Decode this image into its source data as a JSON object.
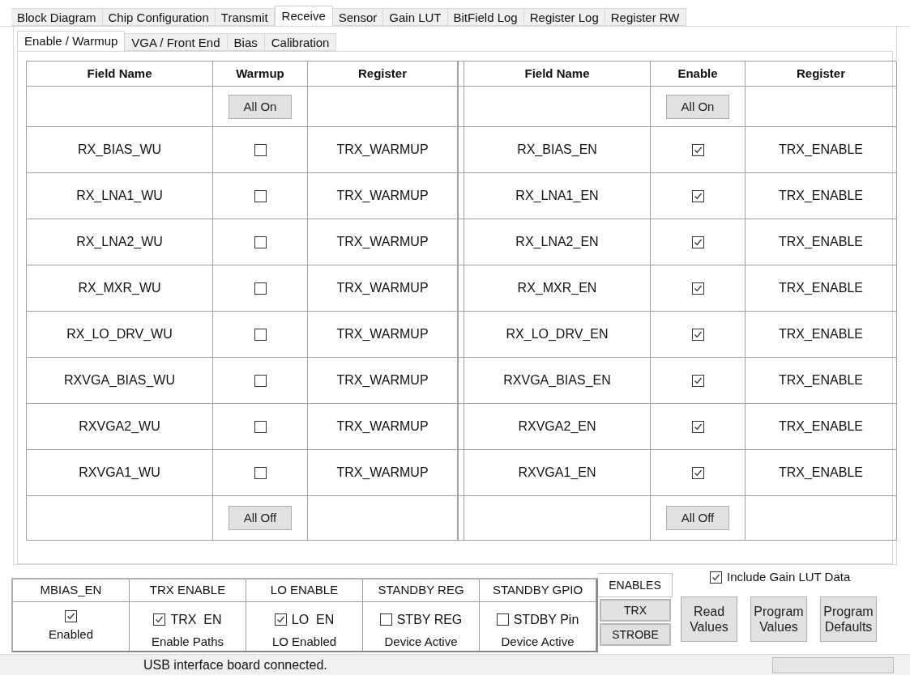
{
  "tabs": [
    {
      "label": "Block Diagram",
      "selected": false
    },
    {
      "label": "Chip Configuration",
      "selected": false
    },
    {
      "label": "Transmit",
      "selected": false
    },
    {
      "label": "Receive",
      "selected": true
    },
    {
      "label": "Sensor",
      "selected": false
    },
    {
      "label": "Gain LUT",
      "selected": false
    },
    {
      "label": "BitField Log",
      "selected": false
    },
    {
      "label": "Register Log",
      "selected": false
    },
    {
      "label": "Register RW",
      "selected": false
    }
  ],
  "subtabs": [
    {
      "label": "Enable / Warmup",
      "selected": true
    },
    {
      "label": "VGA / Front End",
      "selected": false
    },
    {
      "label": "Bias",
      "selected": false
    },
    {
      "label": "Calibration",
      "selected": false
    }
  ],
  "table": {
    "columns": [
      "Field Name",
      "Warmup",
      "Register",
      "Field Name",
      "Enable",
      "Register"
    ],
    "top_buttons": [
      "All On",
      "All On"
    ],
    "rows": [
      {
        "warmup_field": "RX_BIAS_WU",
        "warmup": false,
        "warmup_register": "TRX_WARMUP",
        "enable_field": "RX_BIAS_EN",
        "enabled": true,
        "enable_register": "TRX_ENABLE"
      },
      {
        "warmup_field": "RX_LNA1_WU",
        "warmup": false,
        "warmup_register": "TRX_WARMUP",
        "enable_field": "RX_LNA1_EN",
        "enabled": true,
        "enable_register": "TRX_ENABLE"
      },
      {
        "warmup_field": "RX_LNA2_WU",
        "warmup": false,
        "warmup_register": "TRX_WARMUP",
        "enable_field": "RX_LNA2_EN",
        "enabled": true,
        "enable_register": "TRX_ENABLE"
      },
      {
        "warmup_field": "RX_MXR_WU",
        "warmup": false,
        "warmup_register": "TRX_WARMUP",
        "enable_field": "RX_MXR_EN",
        "enabled": true,
        "enable_register": "TRX_ENABLE"
      },
      {
        "warmup_field": "RX_LO_DRV_WU",
        "warmup": false,
        "warmup_register": "TRX_WARMUP",
        "enable_field": "RX_LO_DRV_EN",
        "enabled": true,
        "enable_register": "TRX_ENABLE"
      },
      {
        "warmup_field": "RXVGA_BIAS_WU",
        "warmup": false,
        "warmup_register": "TRX_WARMUP",
        "enable_field": "RXVGA_BIAS_EN",
        "enabled": true,
        "enable_register": "TRX_ENABLE"
      },
      {
        "warmup_field": "RXVGA2_WU",
        "warmup": false,
        "warmup_register": "TRX_WARMUP",
        "enable_field": "RXVGA2_EN",
        "enabled": true,
        "enable_register": "TRX_ENABLE"
      },
      {
        "warmup_field": "RXVGA1_WU",
        "warmup": false,
        "warmup_register": "TRX_WARMUP",
        "enable_field": "RXVGA1_EN",
        "enabled": true,
        "enable_register": "TRX_ENABLE"
      }
    ],
    "bottom_buttons": [
      "All Off",
      "All Off"
    ]
  },
  "groups": [
    {
      "header": "MBIAS_EN",
      "checked": true,
      "caption": "Enabled"
    },
    {
      "header": "TRX ENABLE",
      "label": "TRX  EN",
      "checked": true,
      "caption": "Enable Paths"
    },
    {
      "header": "LO ENABLE",
      "label": "LO  EN",
      "checked": true,
      "caption": "LO Enabled"
    },
    {
      "header": "STANDBY REG",
      "label": "STBY REG",
      "checked": false,
      "caption": "Device Active"
    },
    {
      "header": "STANDBY GPIO",
      "label": "STDBY Pin",
      "checked": false,
      "caption": "Device Active"
    }
  ],
  "side_tabs": [
    {
      "label": "ENABLES",
      "selected": true
    },
    {
      "label": "TRX",
      "selected": false
    },
    {
      "label": "STROBE",
      "selected": false
    }
  ],
  "include_gain_lut": {
    "label": "Include Gain LUT Data",
    "checked": true
  },
  "buttons": [
    "Read Values",
    "Program Values",
    "Program Defaults"
  ],
  "status_bar": {
    "text": "USB interface board connected.",
    "progress": {
      "level": 0
    }
  }
}
